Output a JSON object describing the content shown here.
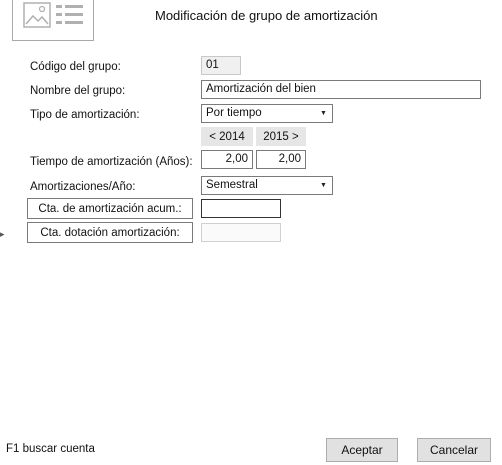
{
  "window": {
    "title": "Modificación de grupo de amortización",
    "header_icon": "form-document-icon"
  },
  "form": {
    "codigo": {
      "label": "Código del grupo:",
      "value": "01"
    },
    "nombre": {
      "label": "Nombre del grupo:",
      "value": "Amortización del bien"
    },
    "tipo": {
      "label": "Tipo de amortización:",
      "value": "Por tiempo"
    },
    "years": {
      "prev": "< 2014",
      "next": "2015 >"
    },
    "tiempo": {
      "label": "Tiempo de amortización (Años):",
      "value_2014": "2,00",
      "value_2015": "2,00"
    },
    "amortizaciones": {
      "label": "Amortizaciones/Año:",
      "value": "Semestral"
    },
    "cta_acum": {
      "label": "Cta. de amortización acum.:",
      "value": ""
    },
    "cta_dotacion": {
      "label": "Cta. dotación amortización:",
      "value": ""
    }
  },
  "footer": {
    "hint": "F1 buscar cuenta",
    "accept_label": "Aceptar",
    "cancel_label": "Cancelar"
  }
}
